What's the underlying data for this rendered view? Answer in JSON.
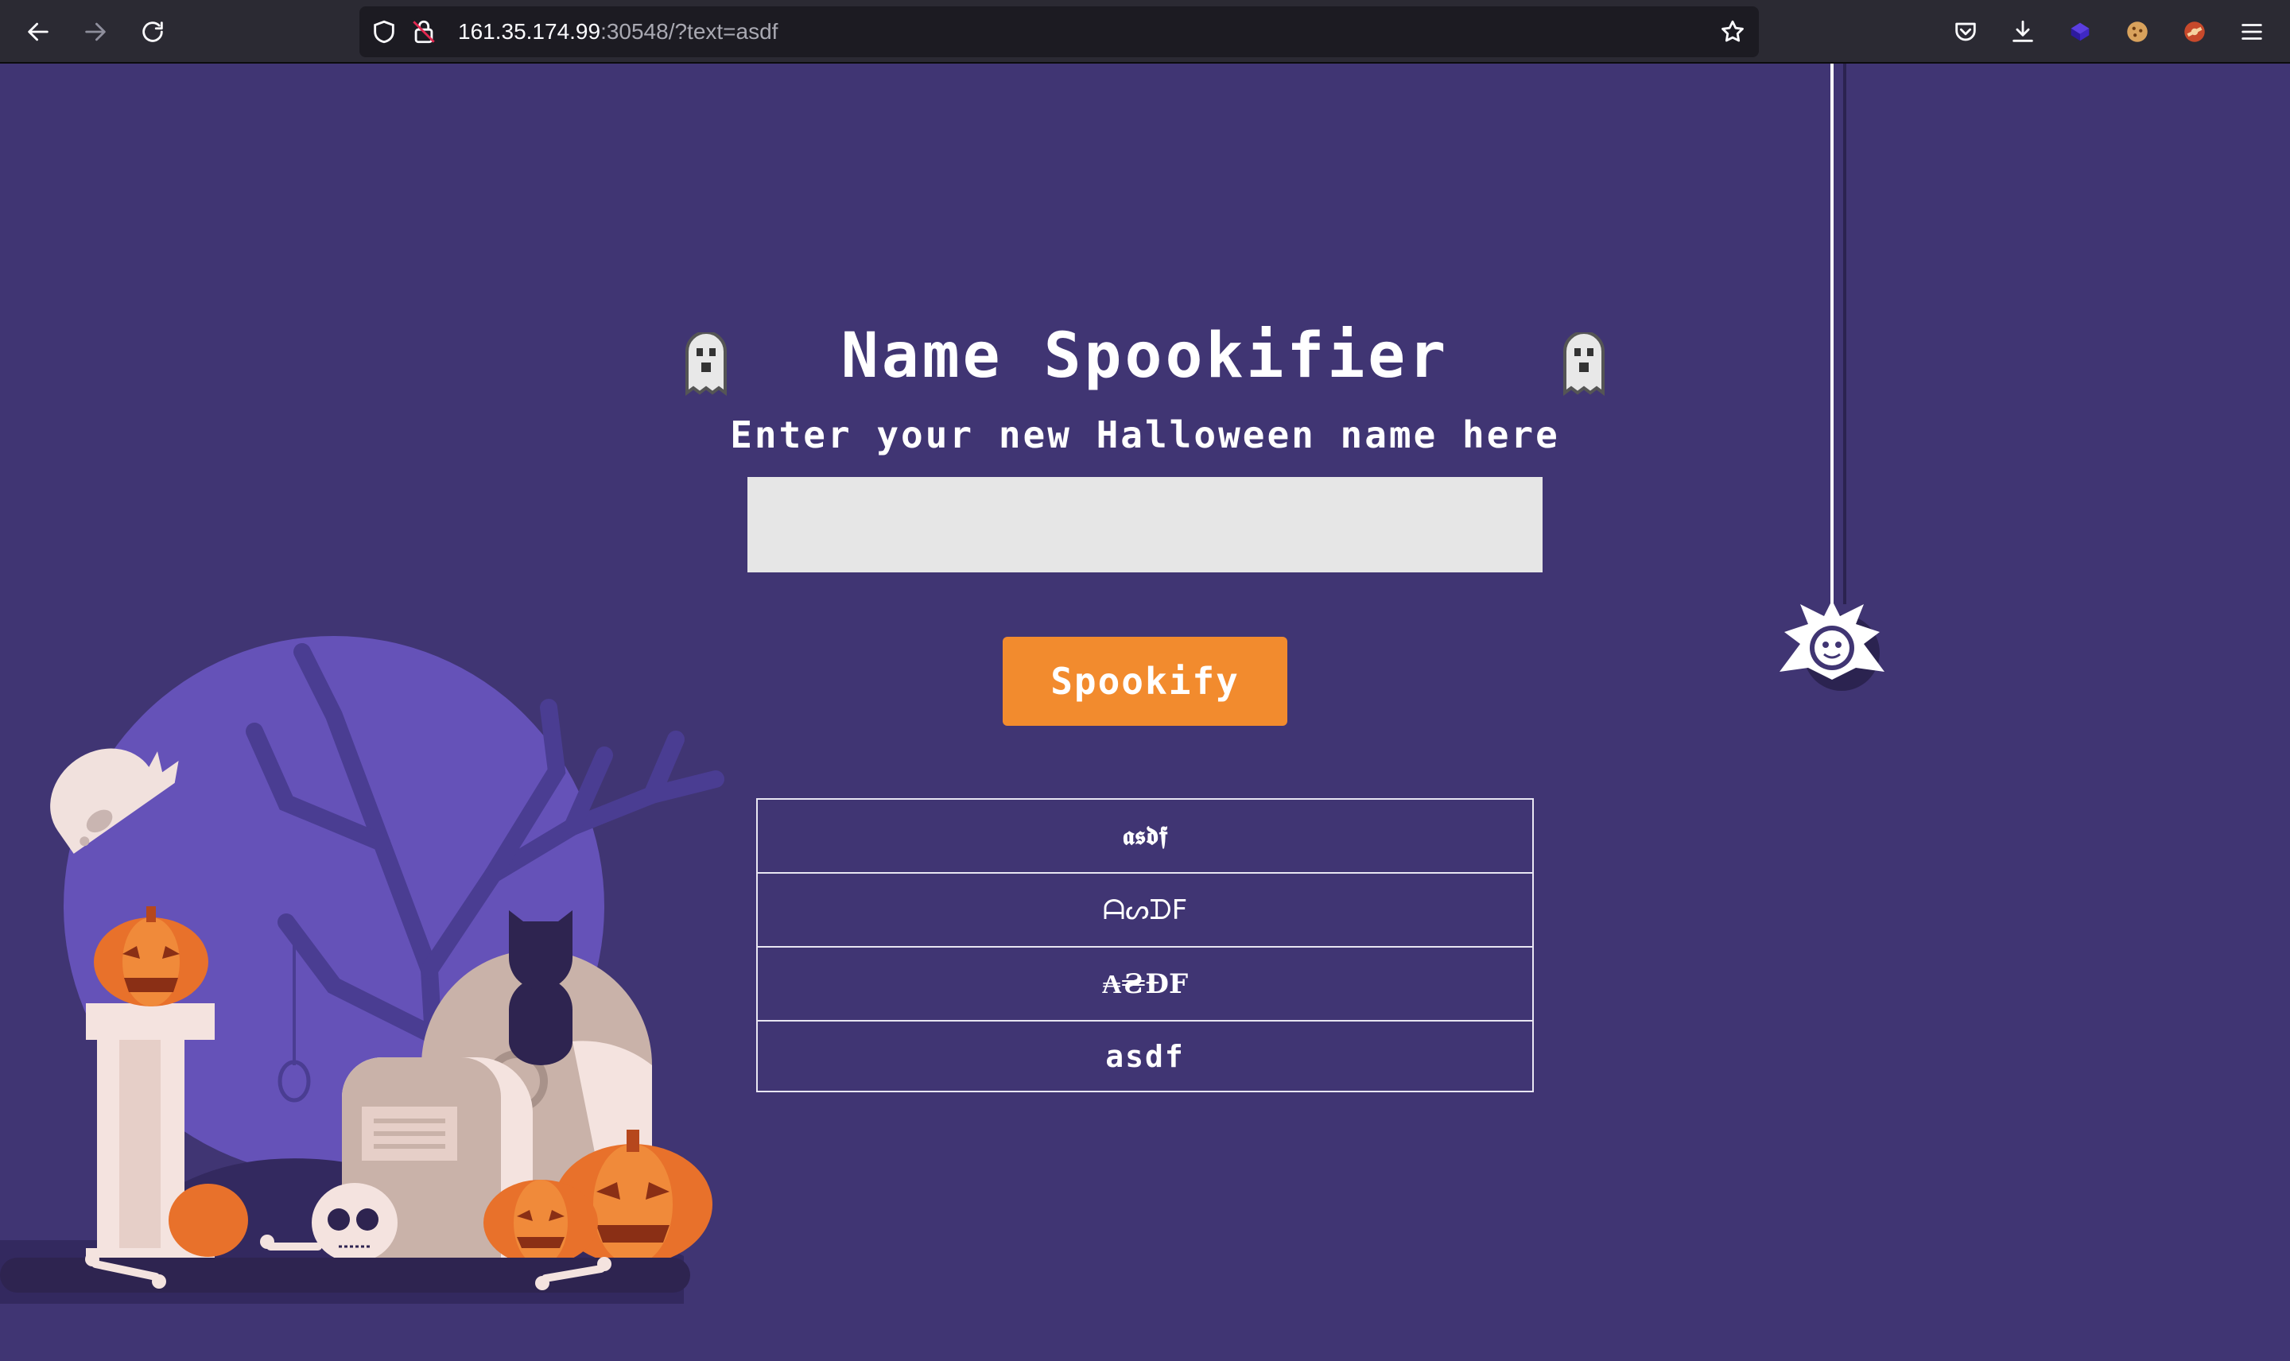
{
  "browser": {
    "url_host": "161.35.174.99",
    "url_rest": ":30548/?text=asdf",
    "nav": {
      "back_icon": "arrow-left-icon",
      "forward_icon": "arrow-right-icon",
      "reload_icon": "reload-icon"
    },
    "toolbar_icons": [
      "pocket-icon",
      "download-icon",
      "extension-cube-icon",
      "cookie-icon",
      "extension-icon",
      "menu-icon"
    ]
  },
  "page": {
    "title": "Name Spookifier",
    "subtitle": "Enter your new Halloween name here",
    "input": {
      "value": "",
      "placeholder": ""
    },
    "button_label": "Spookify",
    "results": [
      "𝖆𝖘𝖉𝖋",
      "ᗩᔕᗪF",
      "₳₴ĐF",
      "asdf"
    ]
  },
  "colors": {
    "background": "#403573",
    "button": "#f28b2e",
    "input": "#e6e6e6",
    "text": "#ffffff"
  }
}
